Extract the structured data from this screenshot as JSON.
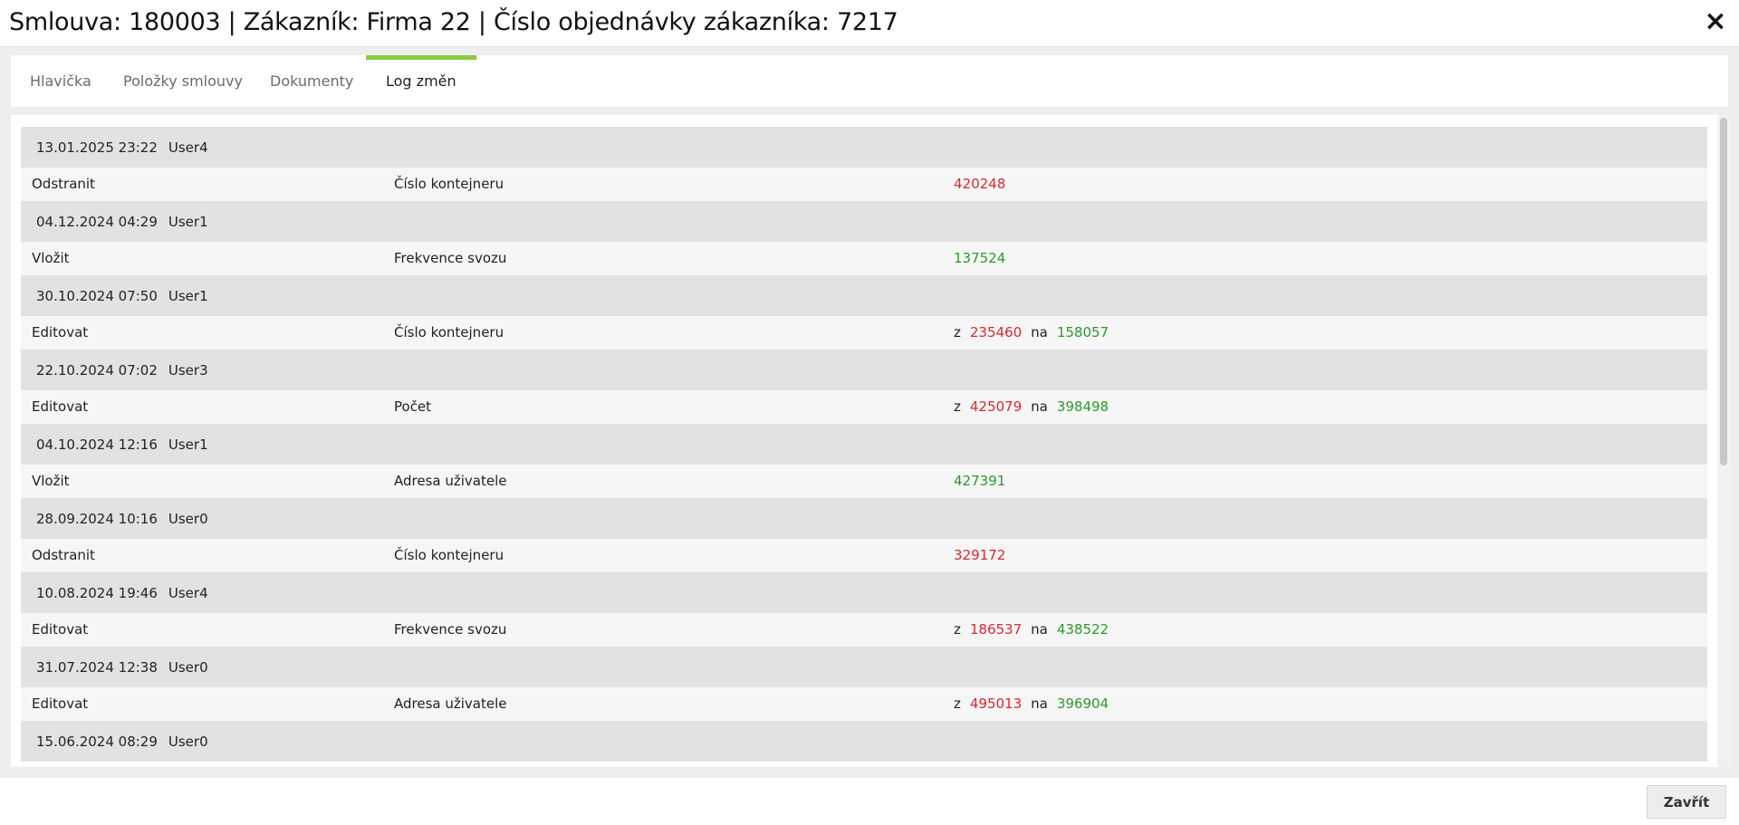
{
  "dialog": {
    "title": "Smlouva: 180003 | Zákazník: Firma 22 | Číslo objednávky zákazníka: 7217",
    "close_icon": "×"
  },
  "tabs": [
    {
      "label": "Hlavička",
      "active": false
    },
    {
      "label": "Položky smlouvy",
      "active": false
    },
    {
      "label": "Dokumenty",
      "active": false
    },
    {
      "label": "Log změn",
      "active": true
    }
  ],
  "log": {
    "from_label": "z",
    "to_label": "na",
    "colors": {
      "removed": "#e0262b",
      "added": "#2b9a2b",
      "accent": "#8dc63f"
    },
    "entries": [
      {
        "datetime": "13.01.2025 23:22",
        "user": "User4",
        "action": "Odstranit",
        "field": "Číslo kontejneru",
        "kind": "removed",
        "value": "420248"
      },
      {
        "datetime": "04.12.2024 04:29",
        "user": "User1",
        "action": "Vložit",
        "field": "Frekvence svozu",
        "kind": "added",
        "value": "137524"
      },
      {
        "datetime": "30.10.2024 07:50",
        "user": "User1",
        "action": "Editovat",
        "field": "Číslo kontejneru",
        "kind": "edit",
        "from": "235460",
        "to": "158057"
      },
      {
        "datetime": "22.10.2024 07:02",
        "user": "User3",
        "action": "Editovat",
        "field": "Počet",
        "kind": "edit",
        "from": "425079",
        "to": "398498"
      },
      {
        "datetime": "04.10.2024 12:16",
        "user": "User1",
        "action": "Vložit",
        "field": "Adresa uživatele",
        "kind": "added",
        "value": "427391"
      },
      {
        "datetime": "28.09.2024 10:16",
        "user": "User0",
        "action": "Odstranit",
        "field": "Číslo kontejneru",
        "kind": "removed",
        "value": "329172"
      },
      {
        "datetime": "10.08.2024 19:46",
        "user": "User4",
        "action": "Editovat",
        "field": "Frekvence svozu",
        "kind": "edit",
        "from": "186537",
        "to": "438522"
      },
      {
        "datetime": "31.07.2024 12:38",
        "user": "User0",
        "action": "Editovat",
        "field": "Adresa uživatele",
        "kind": "edit",
        "from": "495013",
        "to": "396904"
      },
      {
        "datetime": "15.06.2024 08:29",
        "user": "User0"
      }
    ]
  },
  "footer": {
    "close_button": "Zavřít"
  }
}
